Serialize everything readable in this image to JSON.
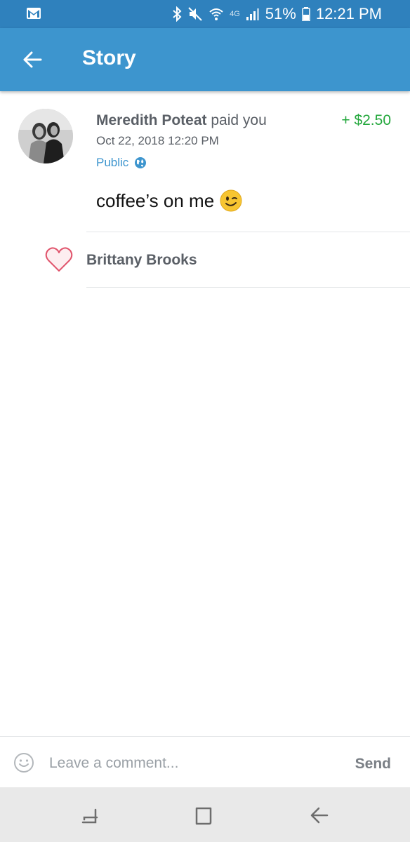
{
  "status_bar": {
    "network": "4G",
    "battery": "51%",
    "time": "12:21 PM"
  },
  "app_bar": {
    "title": "Story"
  },
  "story": {
    "sender": "Meredith Poteat",
    "action": "paid you",
    "amount": "+ $2.50",
    "date": "Oct 22, 2018 12:20 PM",
    "privacy": "Public",
    "note": "coffee’s on me",
    "note_emoji": "winking-face"
  },
  "likes": {
    "names": [
      "Brittany Brooks"
    ]
  },
  "comment": {
    "placeholder": "Leave a comment...",
    "send_label": "Send"
  },
  "colors": {
    "status_bar": "#2f81bd",
    "app_bar": "#3d95ce",
    "amount": "#22a73b",
    "link": "#3d95ce",
    "heart": "#e0536b"
  }
}
